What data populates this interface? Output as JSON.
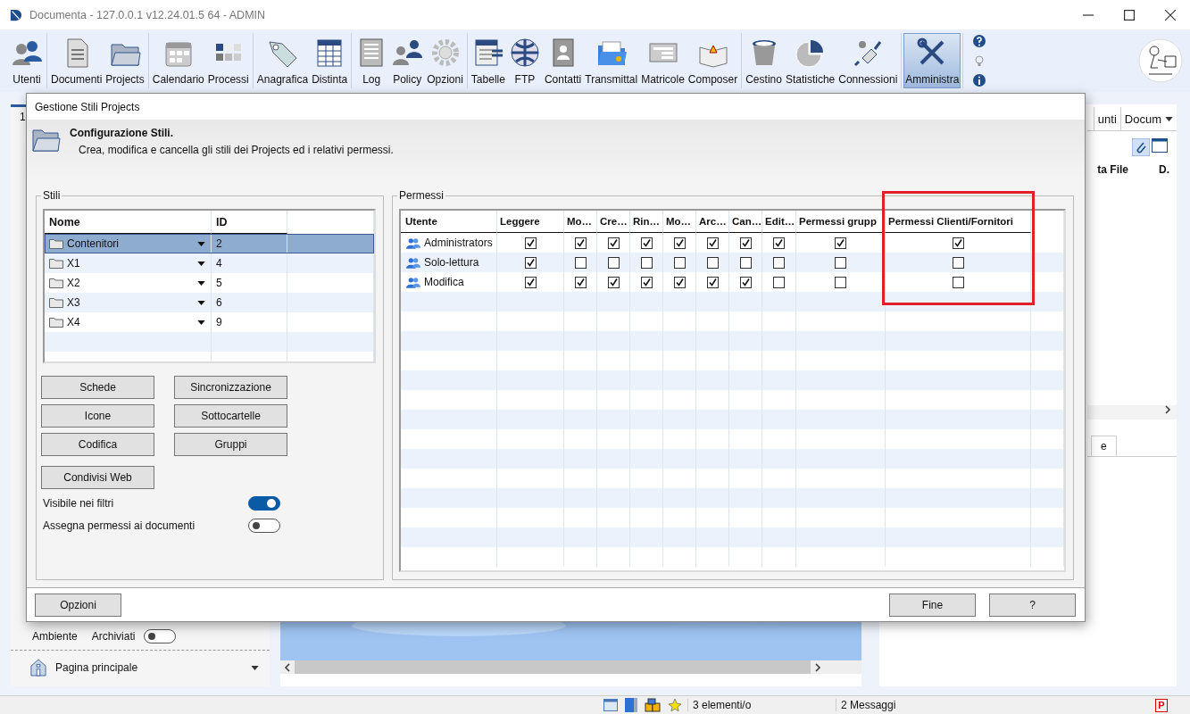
{
  "window": {
    "title": "Documenta - 127.0.0.1 v12.24.01.5 64 - ADMIN"
  },
  "toolbar": {
    "groups": [
      [
        {
          "label": "Utenti",
          "selected": false
        }
      ],
      [
        {
          "label": "Documenti",
          "selected": false
        },
        {
          "label": "Projects",
          "selected": false
        }
      ],
      [
        {
          "label": "Calendario",
          "selected": false
        },
        {
          "label": "Processi",
          "selected": false
        }
      ],
      [
        {
          "label": "Anagrafica",
          "selected": false
        },
        {
          "label": "Distinta",
          "selected": false
        }
      ],
      [
        {
          "label": "Log",
          "selected": false
        },
        {
          "label": "Policy",
          "selected": false
        },
        {
          "label": "Opzioni",
          "selected": false
        }
      ],
      [
        {
          "label": "Tabelle",
          "selected": false
        },
        {
          "label": "FTP",
          "selected": false
        },
        {
          "label": "Contatti",
          "selected": false
        },
        {
          "label": "Transmittal",
          "selected": false
        },
        {
          "label": "Matricole",
          "selected": false
        },
        {
          "label": "Composer",
          "selected": false
        }
      ],
      [
        {
          "label": "Cestino",
          "selected": false
        },
        {
          "label": "Statistiche",
          "selected": false
        },
        {
          "label": "Connessioni",
          "selected": false
        }
      ],
      [
        {
          "label": "Amministra",
          "selected": true
        }
      ]
    ]
  },
  "background": {
    "left_tab": "1",
    "sidebar": {
      "labels": [
        "Ambiente",
        "Archiviati"
      ],
      "toggle_on": false,
      "page": "Pagina principale"
    },
    "right_tabs": [
      "unti",
      "Docum"
    ],
    "right_columns": [
      "ta File",
      "D."
    ],
    "lower_tab": "e"
  },
  "dialog": {
    "title": "Gestione Stili Projects",
    "heading": "Configurazione Stili.",
    "description": "Crea, modifica e cancella gli stili dei Projects ed i relativi permessi.",
    "styles": {
      "legend": "Stili",
      "columns": [
        "Nome",
        "ID"
      ],
      "rows": [
        {
          "name": "Contenitori",
          "id": "2",
          "selected": true
        },
        {
          "name": "X1",
          "id": "4",
          "selected": false
        },
        {
          "name": "X2",
          "id": "5",
          "selected": false
        },
        {
          "name": "X3",
          "id": "6",
          "selected": false
        },
        {
          "name": "X4",
          "id": "9",
          "selected": false
        }
      ]
    },
    "buttons": [
      "Schede",
      "Sincronizzazione",
      "Icone",
      "Sottocartelle",
      "Codifica",
      "Gruppi",
      "Condivisi Web"
    ],
    "toggles": [
      {
        "label": "Visibile nei filtri",
        "on": true
      },
      {
        "label": "Assegna permessi ai documenti",
        "on": false
      }
    ],
    "permissions": {
      "legend": "Permessi",
      "columns": [
        {
          "label": "Utente",
          "highlighted": false
        },
        {
          "label": "Leggere",
          "highlighted": false
        },
        {
          "label": "Mo…",
          "highlighted": false
        },
        {
          "label": "Cre…",
          "highlighted": false
        },
        {
          "label": "Rin…",
          "highlighted": false
        },
        {
          "label": "Mo…",
          "highlighted": false
        },
        {
          "label": "Arc…",
          "highlighted": false
        },
        {
          "label": "Can…",
          "highlighted": false
        },
        {
          "label": "Edit…",
          "highlighted": false
        },
        {
          "label": "Permessi grupp",
          "highlighted": false
        },
        {
          "label": "Permessi Clienti/Fornitori",
          "highlighted": true
        }
      ],
      "rows": [
        {
          "user": "Administrators",
          "checks": [
            true,
            true,
            true,
            true,
            true,
            true,
            true,
            true,
            true,
            true
          ]
        },
        {
          "user": "Solo-lettura",
          "checks": [
            true,
            false,
            false,
            false,
            false,
            false,
            false,
            false,
            false,
            false
          ]
        },
        {
          "user": "Modifica",
          "checks": [
            true,
            true,
            true,
            true,
            true,
            true,
            true,
            false,
            false,
            false
          ]
        }
      ]
    },
    "footer": {
      "left": "Opzioni",
      "right": [
        "Fine",
        "?"
      ]
    }
  },
  "status_bar": {
    "items": [
      "3 elementi/o",
      "2 Messaggi"
    ],
    "badge": "P"
  }
}
